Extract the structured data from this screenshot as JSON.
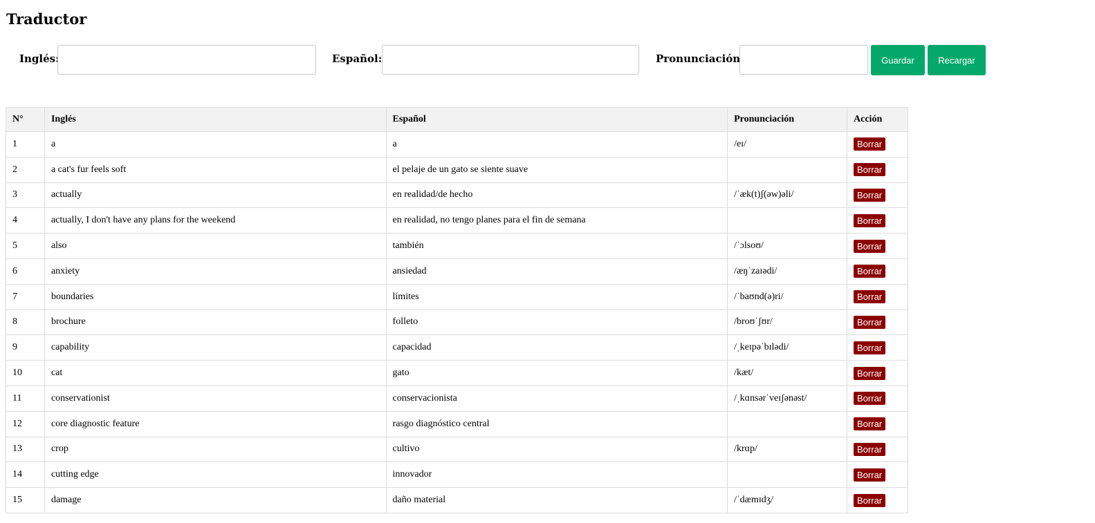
{
  "page": {
    "title": "Traductor"
  },
  "form": {
    "english_label": "Inglés:",
    "spanish_label": "Español:",
    "pronunciation_label": "Pronunciación:",
    "english_value": "",
    "spanish_value": "",
    "pronunciation_value": "",
    "save_label": "Guardar",
    "reload_label": "Recargar"
  },
  "table": {
    "headers": [
      "N°",
      "Inglés",
      "Español",
      "Pronunciación",
      "Acción"
    ],
    "delete_label": "Borrar",
    "rows": [
      {
        "n": "1",
        "en": "a",
        "es": "a",
        "pron": "/eɪ/"
      },
      {
        "n": "2",
        "en": "a cat's fur feels soft",
        "es": "el pelaje de un gato se siente suave",
        "pron": ""
      },
      {
        "n": "3",
        "en": "actually",
        "es": "en realidad/de hecho",
        "pron": "/ˈæk(t)ʃ(əw)əli/"
      },
      {
        "n": "4",
        "en": "actually, I don't have any plans for the weekend",
        "es": "en realidad, no tengo planes para el fin de semana",
        "pron": ""
      },
      {
        "n": "5",
        "en": "also",
        "es": "también",
        "pron": "/ˈɔlsoʊ/"
      },
      {
        "n": "6",
        "en": "anxiety",
        "es": "ansiedad",
        "pron": "/æŋˈzaɪədi/"
      },
      {
        "n": "7",
        "en": "boundaries",
        "es": "límites",
        "pron": "/ˈbaʊnd(ə)ri/"
      },
      {
        "n": "8",
        "en": "brochure",
        "es": "folleto",
        "pron": "/broʊˈʃʊr/"
      },
      {
        "n": "9",
        "en": "capability",
        "es": "capacidad",
        "pron": "/ˌkeɪpəˈbɪlədi/"
      },
      {
        "n": "10",
        "en": "cat",
        "es": "gato",
        "pron": "/kæt/"
      },
      {
        "n": "11",
        "en": "conservationist",
        "es": "conservacionista",
        "pron": "/ˌkɑnsərˈveɪʃənəst/"
      },
      {
        "n": "12",
        "en": "core diagnostic feature",
        "es": "rasgo diagnóstico central",
        "pron": ""
      },
      {
        "n": "13",
        "en": "crop",
        "es": "cultivo",
        "pron": "/krɑp/"
      },
      {
        "n": "14",
        "en": "cutting edge",
        "es": "innovador",
        "pron": ""
      },
      {
        "n": "15",
        "en": "damage",
        "es": "daño material",
        "pron": "/ˈdæmɪdʒ/"
      }
    ]
  }
}
